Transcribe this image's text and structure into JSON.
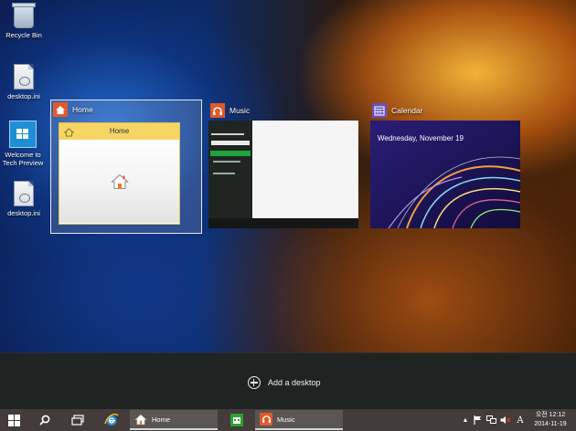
{
  "desktop": {
    "icons": [
      {
        "label": "Recycle Bin",
        "icon": "recycle-bin-icon"
      },
      {
        "label": "desktop.ini",
        "icon": "ini-file-icon"
      },
      {
        "label": "Welcome to Tech Preview",
        "icon": "windows-logo-icon"
      },
      {
        "label": "desktop.ini",
        "icon": "ini-file-icon"
      }
    ]
  },
  "task_view": {
    "windows": [
      {
        "app": "Home",
        "icon": "home-icon",
        "accent": "#e05a2b",
        "thumbnail_title": "Home",
        "selected": true
      },
      {
        "app": "Music",
        "icon": "headphones-icon",
        "accent": "#e05a2b",
        "thumbnail_title": "Music"
      },
      {
        "app": "Calendar",
        "icon": "calendar-icon",
        "accent": "#6b4fbb",
        "thumbnail_date": "Wednesday, November 19"
      }
    ],
    "add_desktop_label": "Add a desktop"
  },
  "taskbar": {
    "start_icon": "windows-logo-icon",
    "search_icon": "search-icon",
    "task_view_icon": "task-view-icon",
    "ie_icon": "internet-explorer-icon",
    "store_icon": "store-icon",
    "apps": [
      {
        "label": "Home",
        "icon": "home-icon"
      },
      {
        "label": "Music",
        "icon": "headphones-icon"
      }
    ],
    "tray": {
      "ime_label": "A",
      "clock_time": "오전 12:12",
      "clock_date": "2014-11-19"
    }
  },
  "colors": {
    "taskbar": "#433c3a",
    "task_view_bg": "#1f2321",
    "home_title_bar": "#f6d565",
    "calendar_accent": "#6b4fbb",
    "music_accent": "#e05a2b",
    "store_green": "#2e9f32"
  }
}
